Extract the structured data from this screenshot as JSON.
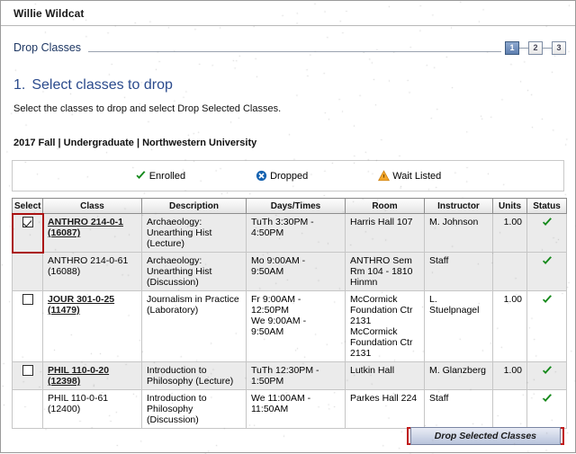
{
  "user": {
    "name": "Willie Wildcat"
  },
  "header": {
    "page_title": "Drop Classes",
    "steps": [
      {
        "label": "1",
        "state": "active"
      },
      {
        "label": "2",
        "state": "inactive"
      },
      {
        "label": "3",
        "state": "inactive"
      }
    ]
  },
  "section": {
    "number": "1.",
    "title": "Select classes to drop",
    "description": "Select the classes to drop and select Drop Selected Classes.",
    "term_line": "2017 Fall | Undergraduate | Northwestern University"
  },
  "legend": {
    "items": [
      {
        "icon": "green-check-icon",
        "label": "Enrolled",
        "color": "#1a8a1a"
      },
      {
        "icon": "blue-x-circle-icon",
        "label": "Dropped",
        "color": "#1763b0"
      },
      {
        "icon": "orange-triangle-icon",
        "label": "Wait Listed",
        "color": "#f0a020"
      }
    ]
  },
  "table": {
    "columns": [
      "Select",
      "Class",
      "Description",
      "Days/Times",
      "Room",
      "Instructor",
      "Units",
      "Status"
    ],
    "rows": [
      {
        "selected": true,
        "highlighted": true,
        "class_link": "ANTHRO 214-0-1",
        "class_number": "(16087)",
        "description": "Archaeology: Unearthing Hist (Lecture)",
        "days_times": "TuTh 3:30PM - 4:50PM",
        "room": "Harris Hall 107",
        "instructor": "M. Johnson",
        "units": "1.00",
        "status": "enrolled"
      },
      {
        "selected": null,
        "highlighted": false,
        "class_link": "",
        "class_plain": "ANTHRO 214-0-61",
        "class_number": "(16088)",
        "description": "Archaeology: Unearthing Hist (Discussion)",
        "days_times": "Mo 9:00AM - 9:50AM",
        "room": "ANTHRO Sem Rm 104 - 1810 Hinmn",
        "instructor": "Staff",
        "units": "",
        "status": "enrolled"
      },
      {
        "selected": false,
        "highlighted": false,
        "class_link": "JOUR 301-0-25",
        "class_number": "(11479)",
        "description": "Journalism in Practice (Laboratory)",
        "days_times": "Fr 9:00AM - 12:50PM\nWe 9:00AM - 9:50AM",
        "room": "McCormick Foundation Ctr 2131\nMcCormick Foundation Ctr 2131",
        "instructor": "L. Stuelpnagel",
        "units": "1.00",
        "status": "enrolled"
      },
      {
        "selected": false,
        "highlighted": false,
        "class_link": "PHIL 110-0-20",
        "class_number": "(12398)",
        "description": "Introduction to Philosophy (Lecture)",
        "days_times": "TuTh 12:30PM - 1:50PM",
        "room": "Lutkin Hall",
        "instructor": "M. Glanzberg",
        "units": "1.00",
        "status": "enrolled"
      },
      {
        "selected": null,
        "highlighted": false,
        "class_link": "",
        "class_plain": "PHIL 110-0-61",
        "class_number": "(12400)",
        "description": "Introduction to Philosophy (Discussion)",
        "days_times": "We 11:00AM - 11:50AM",
        "room": "Parkes Hall 224",
        "instructor": "Staff",
        "units": "",
        "status": "enrolled"
      }
    ]
  },
  "footer": {
    "drop_button_label": "Drop Selected Classes"
  },
  "colors": {
    "accent": "#2b4b8d",
    "highlight": "#c01a1a",
    "enrolled": "#1a8a1a",
    "dropped": "#1763b0",
    "waitlisted": "#f0a020"
  }
}
